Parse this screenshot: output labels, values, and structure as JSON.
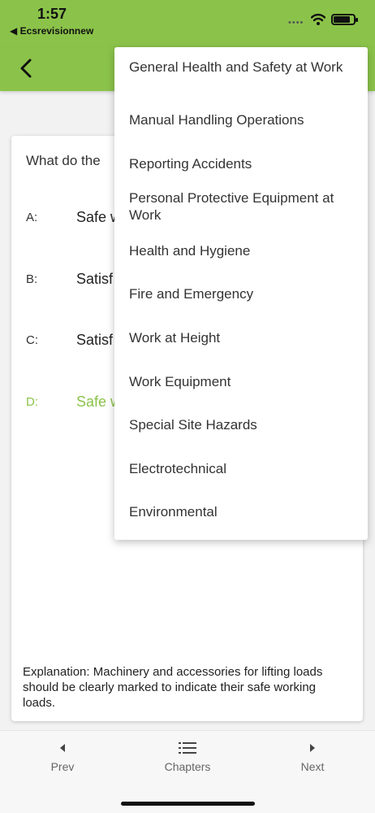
{
  "status": {
    "time": "1:57",
    "back_app": "◀ Ecsrevisionnew",
    "signal": "••••"
  },
  "colors": {
    "accent": "#8bc34a"
  },
  "question": {
    "text": "What do the"
  },
  "options": [
    {
      "letter": "A:",
      "text": "Safe w"
    },
    {
      "letter": "B:",
      "text": "Satisf"
    },
    {
      "letter": "C:",
      "text": "Satisf"
    },
    {
      "letter": "D:",
      "text": "Safe w",
      "correct": true
    }
  ],
  "explanation": "Explanation: Machinery and accessories for lifting loads should be clearly marked to indicate their safe working loads.",
  "menu": {
    "items": [
      "General Health and Safety at Work",
      "Manual Handling Operations",
      "Reporting Accidents",
      "Personal Protective Equipment at Work",
      "Health and Hygiene",
      "Fire and Emergency",
      "Work at Height",
      "Work Equipment",
      "Special Site Hazards",
      "Electrotechnical",
      "Environmental"
    ]
  },
  "nav": {
    "prev": "Prev",
    "chapters": "Chapters",
    "next": "Next"
  }
}
